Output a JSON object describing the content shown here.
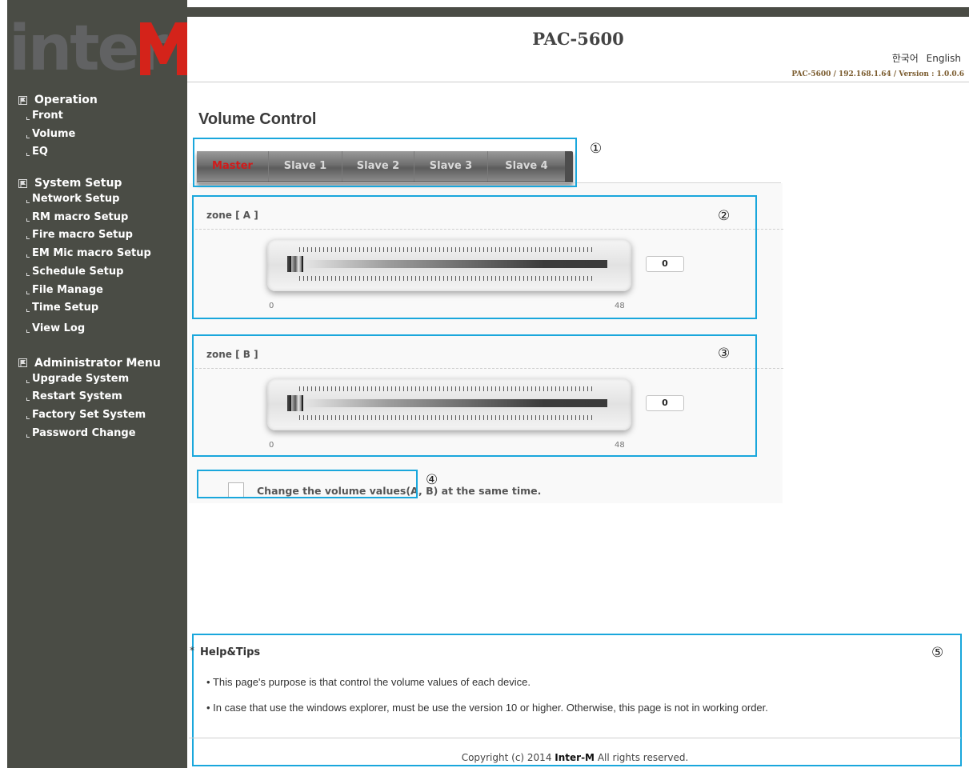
{
  "brand": {
    "logo_text": "inter",
    "logo_letter": "M",
    "logo_color": "#d4231a"
  },
  "header": {
    "title": "PAC-5600",
    "languages": [
      "한국어",
      "English"
    ],
    "version_info": "PAC-5600 / 192.168.1.64 / Version : 1.0.0.6"
  },
  "sidebar": {
    "groups": [
      {
        "label": "Operation",
        "items": [
          "Front",
          "Volume",
          "EQ"
        ]
      },
      {
        "label": "System Setup",
        "items": [
          "Network Setup",
          "RM macro Setup",
          "Fire macro Setup",
          "EM Mic macro Setup",
          "Schedule Setup",
          "File Manage",
          "Time Setup",
          "View Log"
        ]
      },
      {
        "label": "Administrator Menu",
        "items": [
          "Upgrade System",
          "Restart System",
          "Factory Set System",
          "Password Change"
        ]
      }
    ]
  },
  "main": {
    "page_title": "Volume Control",
    "tabs": [
      {
        "label": "Master",
        "active": true
      },
      {
        "label": "Slave 1",
        "active": false
      },
      {
        "label": "Slave 2",
        "active": false
      },
      {
        "label": "Slave 3",
        "active": false
      },
      {
        "label": "Slave 4",
        "active": false
      }
    ],
    "zones": [
      {
        "label": "zone [ A ]",
        "value": "0",
        "min": "0",
        "max": "48"
      },
      {
        "label": "zone [ B ]",
        "value": "0",
        "min": "0",
        "max": "48"
      }
    ],
    "same_time_label": "Change the volume values(A, B) at the same time.",
    "same_time_checked": false
  },
  "callouts": [
    "①",
    "②",
    "③",
    "④",
    "⑤"
  ],
  "help": {
    "title": "Help&Tips",
    "star": "*",
    "items": [
      "This page's purpose is that control the volume values of each device.",
      "In case that use the windows explorer, must be use the version 10 or higher. Otherwise, this page is not in working order."
    ]
  },
  "footer": {
    "copyright_prefix": "Copyright (c) 2014 ",
    "copyright_brand": "Inter-M",
    "copyright_suffix": " All rights reserved."
  },
  "colors": {
    "sidebar": "#4a4c45",
    "callout": "#1aa7dc",
    "active_tab": "#d11a1a"
  }
}
